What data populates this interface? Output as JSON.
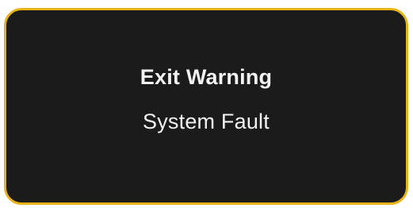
{
  "warning": {
    "title": "Exit Warning",
    "message": "System Fault"
  },
  "colors": {
    "panel_background": "#1b1b1b",
    "panel_border": "#e8b319",
    "text": "#f2f2f2"
  }
}
